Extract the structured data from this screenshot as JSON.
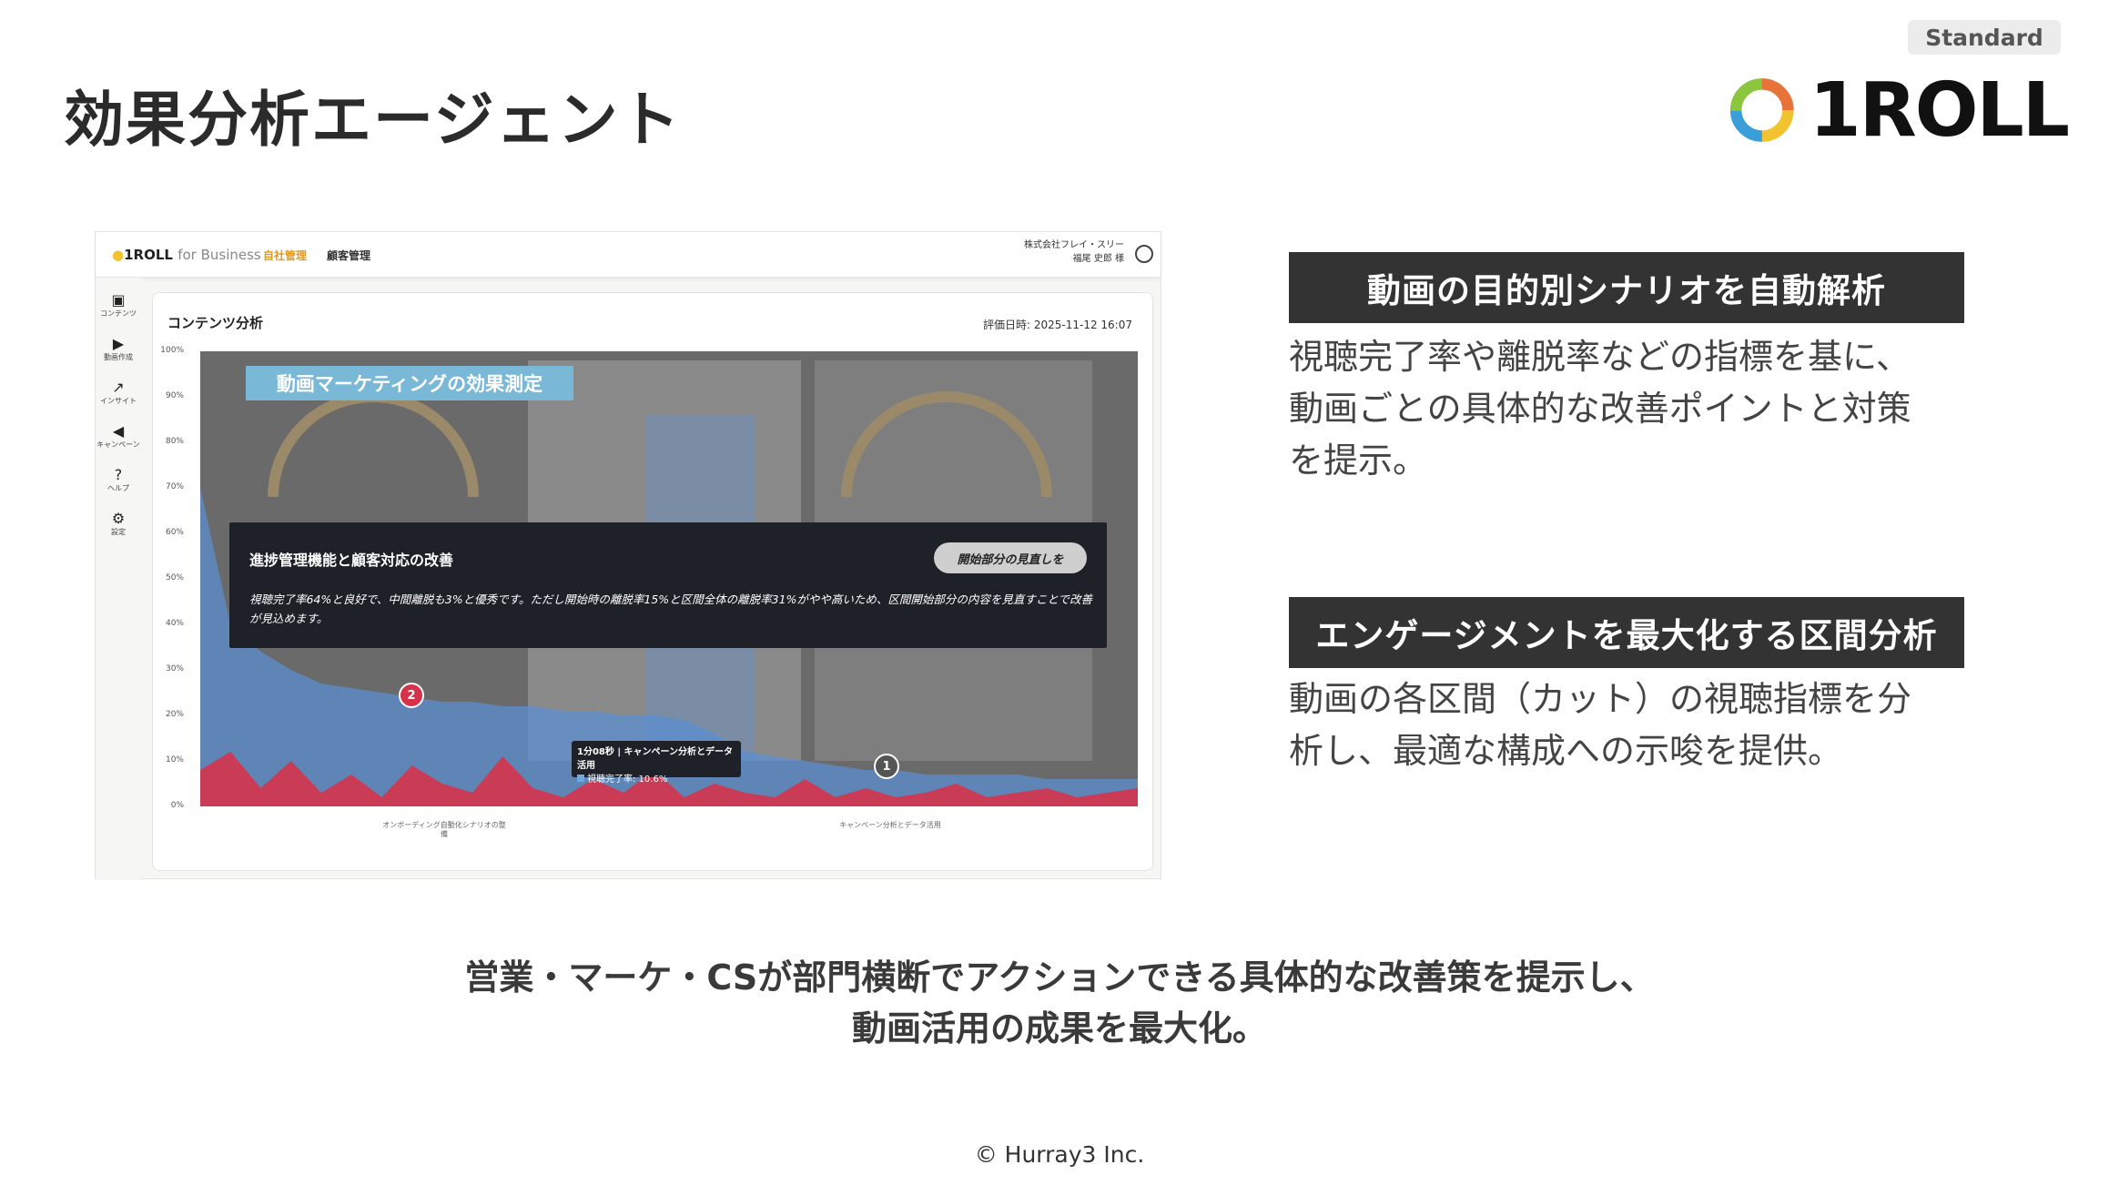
{
  "header": {
    "title": "効果分析エージェント",
    "plan_badge": "Standard",
    "brand_name": "1ROLL"
  },
  "screenshot": {
    "app_logo": "1ROLL",
    "app_logo_sub": "for Business",
    "nav": [
      "自社管理",
      "顧客管理"
    ],
    "company": "株式会社フレイ・スリー",
    "user": "福尾 史郎 様",
    "sidebar": [
      {
        "label": "コンテンツ",
        "icon": "content-icon"
      },
      {
        "label": "動画作成",
        "icon": "video-create-icon"
      },
      {
        "label": "インサイト",
        "icon": "insight-icon"
      },
      {
        "label": "キャンペーン",
        "icon": "campaign-icon"
      },
      {
        "label": "ヘルプ",
        "icon": "help-icon"
      },
      {
        "label": "設定",
        "icon": "settings-icon"
      }
    ],
    "card_title": "コンテンツ分析",
    "evaluation_date": "評価日時: 2025-11-12 16:07",
    "overlay_title": "動画マーケティングの効果測定",
    "insight": {
      "title": "進捗管理機能と顧客対応の改善",
      "chip": "開始部分の見直しを",
      "body": "視聴完了率64%と良好で、中間離脱も3%と優秀です。ただし開始時の離脱率15%と区間全体の離脱率31%がやや高いため、区間開始部分の内容を見直すことで改善が見込めます。"
    },
    "markers": [
      "2",
      "1"
    ],
    "tooltip": {
      "title": "1分08秒 | キャンペーン分析とデータ活用",
      "value": "視聴完了率: 10.6%"
    },
    "x_ticks": [
      "オンボーディング自動化シナリオの整備",
      "キャンペーン分析とデータ活用"
    ],
    "colors": {
      "area_blue": "#5b8fd0",
      "area_red": "#d6334a",
      "accent_orange": "#e39a1a"
    }
  },
  "chart_data": {
    "type": "area",
    "yticks": [
      "100%",
      "90%",
      "80%",
      "70%",
      "60%",
      "50%",
      "40%",
      "30%",
      "20%",
      "10%",
      "0%"
    ],
    "ylim": [
      0,
      100
    ],
    "series": [
      {
        "values": [
          70,
          40,
          34,
          30,
          27,
          26,
          25,
          24,
          23,
          23,
          22,
          22,
          21,
          21,
          20,
          20,
          19,
          16,
          12,
          11,
          10,
          9,
          8,
          8,
          7,
          7,
          7,
          7,
          6,
          6,
          6,
          6
        ]
      },
      {
        "values": [
          8,
          12,
          4,
          10,
          3,
          7,
          2,
          9,
          5,
          3,
          11,
          4,
          2,
          6,
          3,
          8,
          2,
          5,
          3,
          2,
          6,
          2,
          4,
          2,
          3,
          5,
          2,
          3,
          4,
          2,
          3,
          4
        ]
      }
    ]
  },
  "features": [
    {
      "title": "動画の目的別シナリオを自動解析",
      "body": [
        "視聴完了率や離脱率などの指標を基に、",
        "動画ごとの具体的な改善ポイントと対策",
        "を提示。"
      ]
    },
    {
      "title": "エンゲージメントを最大化する区間分析",
      "body": [
        "動画の各区間（カット）の視聴指標を分",
        "析し、最適な構成への示唆を提供。"
      ]
    }
  ],
  "summary": [
    "営業・マーケ・CSが部門横断でアクションできる具体的な改善策を提示し、",
    "動画活用の成果を最大化。"
  ],
  "copyright": "© Hurray3 Inc."
}
